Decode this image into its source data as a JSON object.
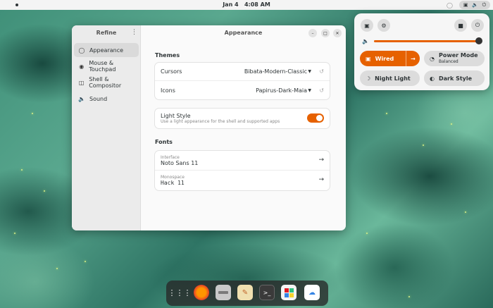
{
  "topbar": {
    "date": "Jan 4",
    "time": "4:08 AM"
  },
  "window": {
    "sidebar_title": "Refine",
    "title": "Appearance",
    "sidebar_items": [
      {
        "label": "Appearance",
        "icon": "palette-icon"
      },
      {
        "label": "Mouse & Touchpad",
        "icon": "mouse-icon"
      },
      {
        "label": "Shell & Compositor",
        "icon": "shell-icon"
      },
      {
        "label": "Sound",
        "icon": "speaker-icon"
      }
    ],
    "themes": {
      "heading": "Themes",
      "cursors_label": "Cursors",
      "cursors_value": "Bibata-Modern-Classic",
      "icons_label": "Icons",
      "icons_value": "Papirus-Dark-Maia"
    },
    "light_style": {
      "label": "Light Style",
      "description": "Use a light appearance for the shell and supported apps",
      "enabled": true
    },
    "fonts": {
      "heading": "Fonts",
      "interface_label": "Interface",
      "interface_value": "Noto Sans 11",
      "monospace_label": "Monospace",
      "monospace_value": "Hack 11"
    }
  },
  "quick_settings": {
    "volume_fraction": 0.97,
    "wired_label": "Wired",
    "power_mode_label": "Power Mode",
    "power_mode_value": "Balanced",
    "night_light_label": "Night Light",
    "dark_style_label": "Dark Style",
    "accent_color": "#e66100"
  },
  "dock": {
    "apps": [
      "app-grid-icon",
      "firefox-icon",
      "files-icon",
      "text-editor-icon",
      "terminal-icon",
      "software-icon",
      "weather-icon"
    ]
  }
}
